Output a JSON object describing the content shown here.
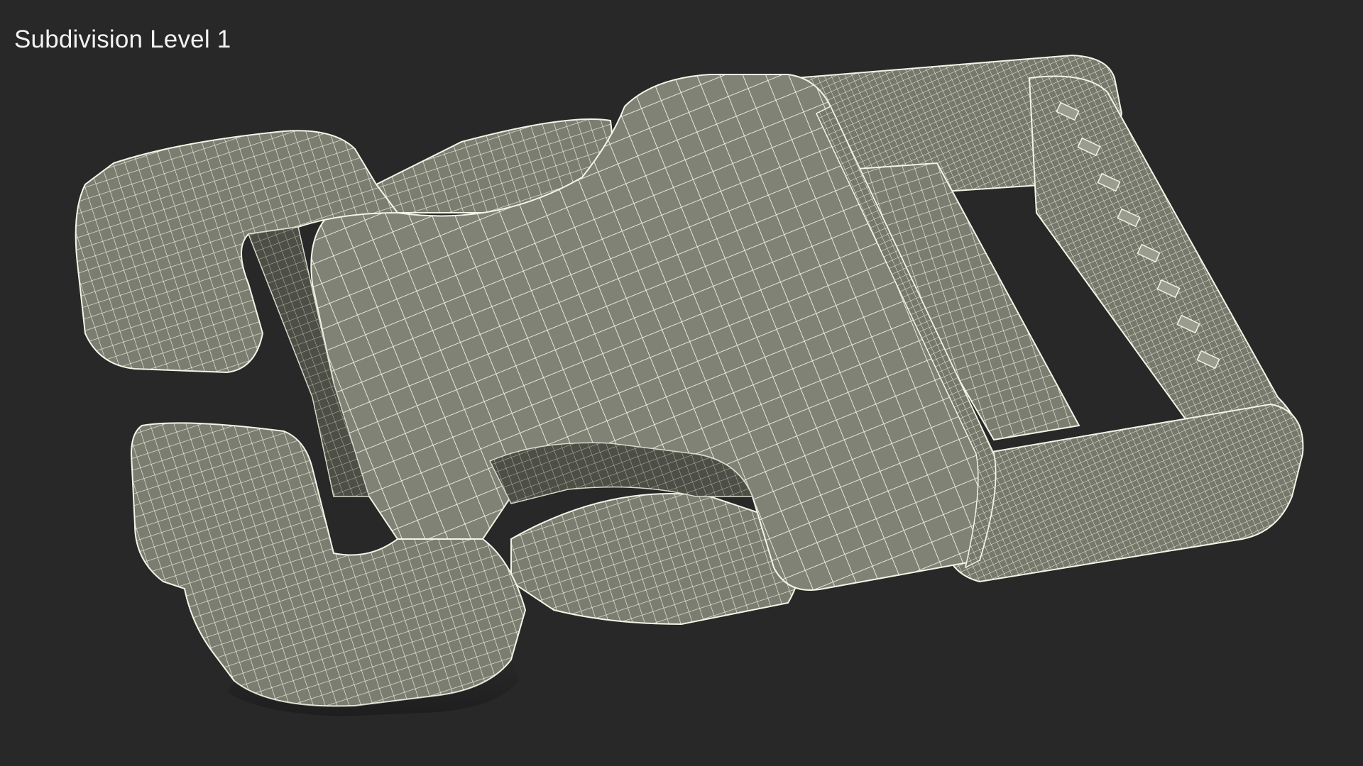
{
  "viewport": {
    "caption": "Subdivision Level 1",
    "background_color": "#282828",
    "surface_color": "#7e8072",
    "wire_color": "#f4f4e6"
  },
  "model": {
    "subject": "side release buckle wireframe render",
    "icon": "buckle-mesh-icon"
  }
}
